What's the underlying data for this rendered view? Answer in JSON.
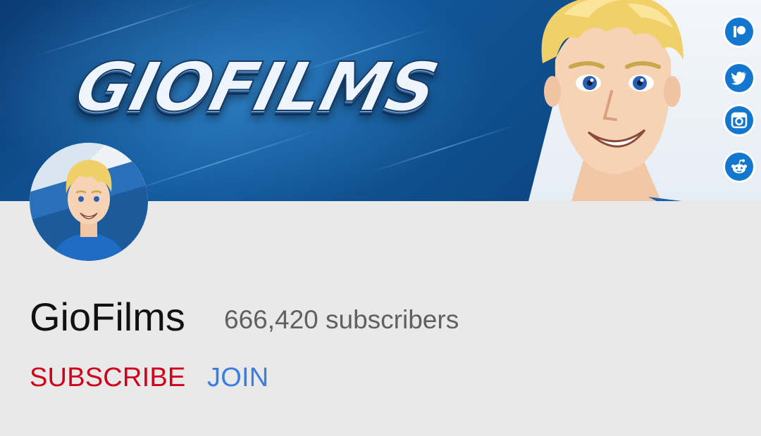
{
  "banner": {
    "title": "GIOFILMS",
    "social_icons": [
      "patreon-icon",
      "twitter-icon",
      "instagram-icon",
      "reddit-icon"
    ]
  },
  "channel": {
    "name": "GioFilms",
    "subscribers": "666,420 subscribers"
  },
  "actions": {
    "subscribe_label": "SUBSCRIBE",
    "join_label": "JOIN"
  },
  "colors": {
    "subscribe": "#d0021b",
    "join": "#3a7ee4",
    "background": "#e9e9e9",
    "banner_blue": "#125a9e",
    "social_blue": "#1477cf"
  }
}
